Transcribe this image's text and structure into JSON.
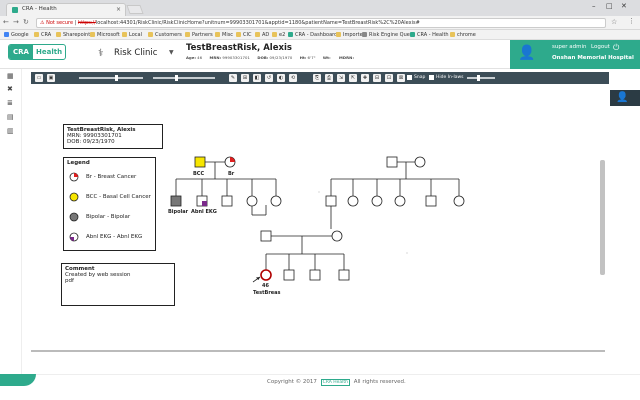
{
  "browser": {
    "tab_title": "CRA - Health",
    "tab_close": "×",
    "window_controls": [
      "–",
      "□",
      "✕"
    ],
    "nav": [
      "←",
      "→",
      "↻"
    ],
    "security_label": "Not secure",
    "url_scheme": "https://",
    "url_rest": "localhost:44301/RiskClinic/RiskClinicHome?unitnum=99903301701&apptid=1180&patientName=TestBreastRisk%2C%20Alexis#",
    "bookmarks": [
      "Google",
      "CRA",
      "Sharepoint",
      "Microsoft",
      "Local",
      "Customers",
      "Partners",
      "Misc",
      "CIC",
      "AD",
      "e2",
      "CRA - Dashboard",
      "Imported",
      "Risk Engine Query",
      "CRA - Health",
      "chrome"
    ]
  },
  "app": {
    "logo_left": "CRA",
    "logo_right": "Health",
    "module_title": "Risk Clinic",
    "patient_name": "TestBreastRisk, Alexis",
    "meta": [
      {
        "label": "Age:",
        "value": "46"
      },
      {
        "label": "MRN:",
        "value": "99903301701"
      },
      {
        "label": "DOB:",
        "value": "09/23/1970"
      },
      {
        "label": "Ht:",
        "value": "6'7\""
      },
      {
        "label": "Wt:",
        "value": ""
      },
      {
        "label": "MDRN:",
        "value": ""
      }
    ],
    "user_role": "super admin",
    "logout_label": "Logout",
    "hospital": "Onshan Memorial Hospital"
  },
  "toolbar": {
    "snap_label": "Snap",
    "hide_inlaws_label": "Hide In-laws"
  },
  "pedigree": {
    "info_name": "TestBreastRisk, Alexis",
    "info_mrn": "MRN: 99903301701",
    "info_dob": "DOB: 09/23/1970",
    "legend_title": "Legend",
    "legend_items": [
      {
        "label": "Br - Breast Cancer",
        "color": "#e02020"
      },
      {
        "label": "BCC - Basal Cell Cancer",
        "color": "#f7e600"
      },
      {
        "label": "Bipolar - Bipolar",
        "color": "#777777"
      },
      {
        "label": "Abnl EKG - Abnl EKG",
        "color": "#7a2a8a"
      }
    ],
    "comment_title": "Comment",
    "comment_text": "Created by web session",
    "comment_text2": "pdf",
    "labels": {
      "gp1_m": "BCC",
      "gp1_f": "Br",
      "child_bipolar": "Bipolar",
      "child_ekg": "Abnl EKG",
      "proband_age": "46",
      "proband_name": "TestBreas"
    }
  },
  "footer": {
    "copyright_pre": "Copyright © 2017",
    "brand": "CRA Health",
    "copyright_post": "All rights reserved."
  }
}
